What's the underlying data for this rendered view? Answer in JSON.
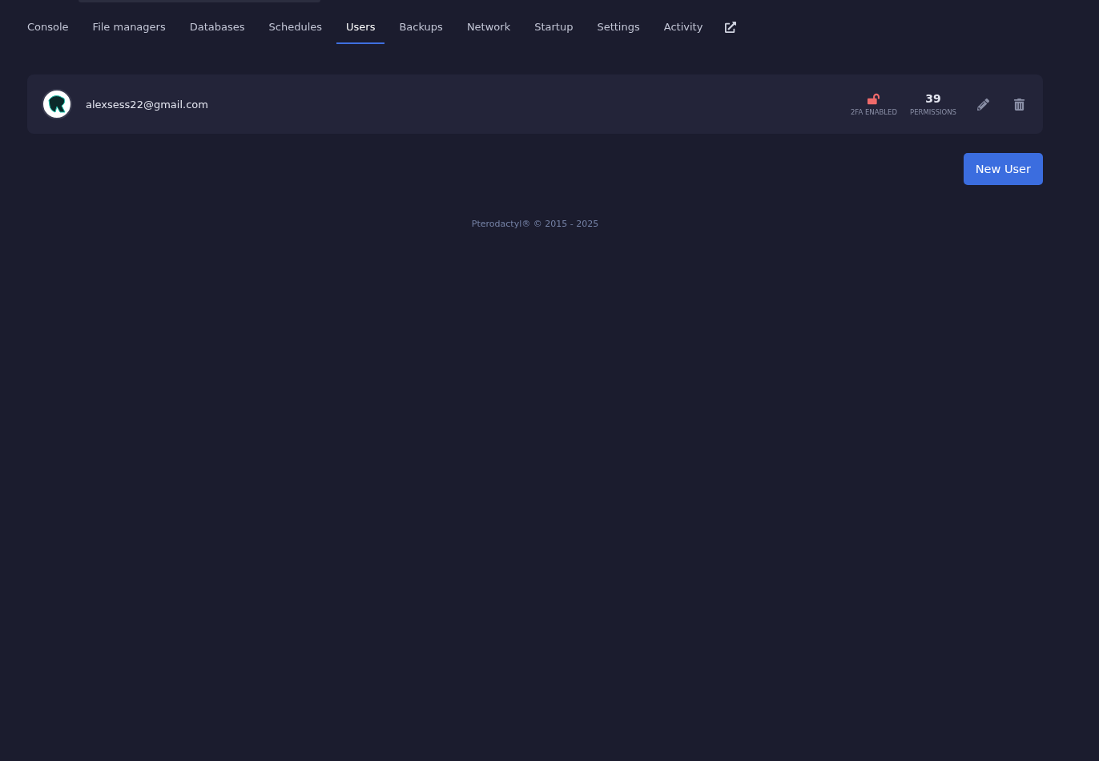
{
  "tabs": [
    {
      "label": "Console",
      "selected": false
    },
    {
      "label": "File managers",
      "selected": false
    },
    {
      "label": "Databases",
      "selected": false
    },
    {
      "label": "Schedules",
      "selected": false
    },
    {
      "label": "Users",
      "selected": true
    },
    {
      "label": "Backups",
      "selected": false
    },
    {
      "label": "Network",
      "selected": false
    },
    {
      "label": "Startup",
      "selected": false
    },
    {
      "label": "Settings",
      "selected": false
    },
    {
      "label": "Activity",
      "selected": false
    }
  ],
  "users": [
    {
      "email": "alexsess22@gmail.com",
      "two_factor_label": "2FA ENABLED",
      "permissions_count": "39",
      "permissions_label": "PERMISSIONS"
    }
  ],
  "new_user_button": "New User",
  "footer": "Pterodactyl® © 2015 - 2025"
}
